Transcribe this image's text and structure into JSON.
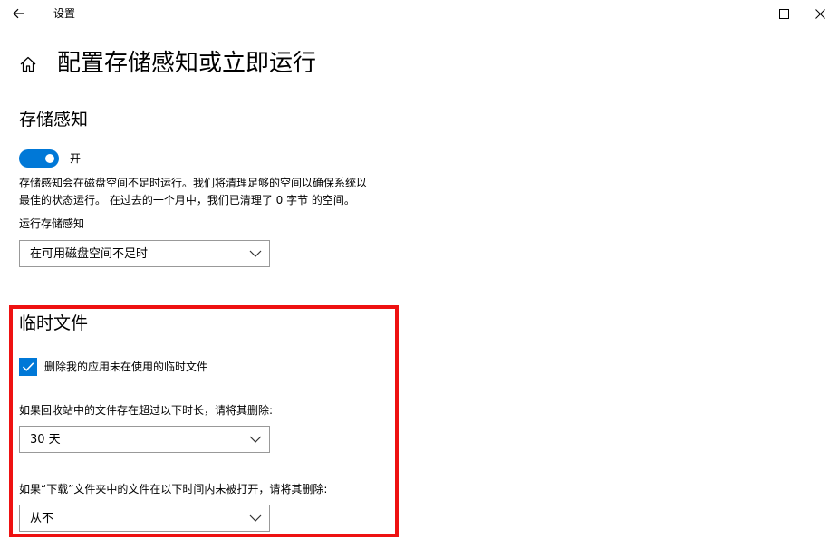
{
  "window": {
    "title": "设置",
    "back_icon": "arrow-left-icon",
    "minimize_icon": "minimize-icon",
    "maximize_icon": "maximize-icon",
    "close_icon": "close-icon"
  },
  "header": {
    "home_icon": "home-icon",
    "title": "配置存储感知或立即运行"
  },
  "storage_sense": {
    "title": "存储感知",
    "toggle": {
      "state": true,
      "label": "开",
      "color": "#0078d7"
    },
    "description_line1": "存储感知会在磁盘空间不足时运行。我们将清理足够的空间以确保系统以",
    "description_line2": "最佳的状态运行。 在过去的一个月中，我们已清理了 0 字节 的空间。",
    "run_label": "运行存储感知",
    "run_select": {
      "value": "在可用磁盘空间不足时"
    }
  },
  "temp_files": {
    "title": "临时文件",
    "delete_checkbox": {
      "checked": true,
      "label": "删除我的应用未在使用的临时文件"
    },
    "recycle_label": "如果回收站中的文件存在超过以下时长，请将其删除:",
    "recycle_select": {
      "value": "30 天"
    },
    "downloads_label": "如果“下载”文件夹中的文件在以下时间内未被打开，请将其删除:",
    "downloads_select": {
      "value": "从不"
    }
  },
  "colors": {
    "accent": "#0078d7",
    "highlight_border": "#ee1111"
  }
}
